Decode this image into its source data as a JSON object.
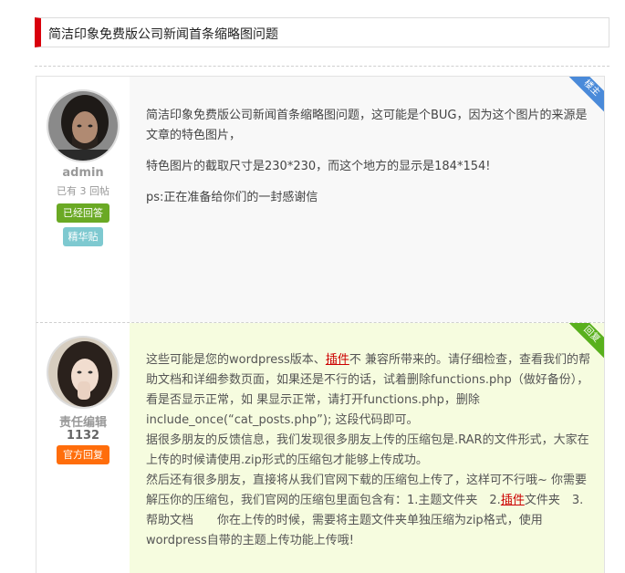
{
  "thread": {
    "title": "简洁印象免费版公司新闻首条缩略图问题"
  },
  "posts": [
    {
      "corner_label": "楼主",
      "username": "admin",
      "meta": "已有 3 回帖",
      "badges": [
        "已经回答",
        "精华贴"
      ],
      "paragraphs": [
        "简洁印象免费版公司新闻首条缩略图问题，这可能是个BUG，因为这个图片的来源是文章的特色图片，",
        "特色图片的截取尺寸是230*230，而这个地方的显示是184*154!",
        "ps:正在准备给你们的一封感谢信"
      ]
    },
    {
      "corner_label": "回复",
      "username": "责任编辑",
      "meta": "1132",
      "badges": [
        "官方回复"
      ],
      "text": {
        "part1": "这些可能是您的wordpress版本、",
        "link1": "插件",
        "part2": "不 兼容所带来的。请仔细检查，查看我们的帮助文档和详细参数页面，如果还是不行的话，试着删除functions.php（做好备份），看是否显示正常，如 果显示正常，请打开functions.php，删除 include_once(“cat_posts.php”); 这段代码即可。",
        "part3": "据很多朋友的反馈信息，我们发现很多朋友上传的压缩包是.RAR的文件形式，大家在上传的时候请使用.zip形式的压缩包才能够上传成功。",
        "part4": "然后还有很多朋友，直接将从我们官网下载的压缩包上传了，这样可不行哦~ 你需要解压你的压缩包，我们官网的压缩包里面包含有：1.主题文件夹　2.",
        "link2": "插件",
        "part5": "文件夹　3. 帮助文档　　你在上传的时候，需要将主题文件夹单独压缩为zip格式，使用wordpress自带的主题上传功能上传哦!"
      }
    }
  ]
}
